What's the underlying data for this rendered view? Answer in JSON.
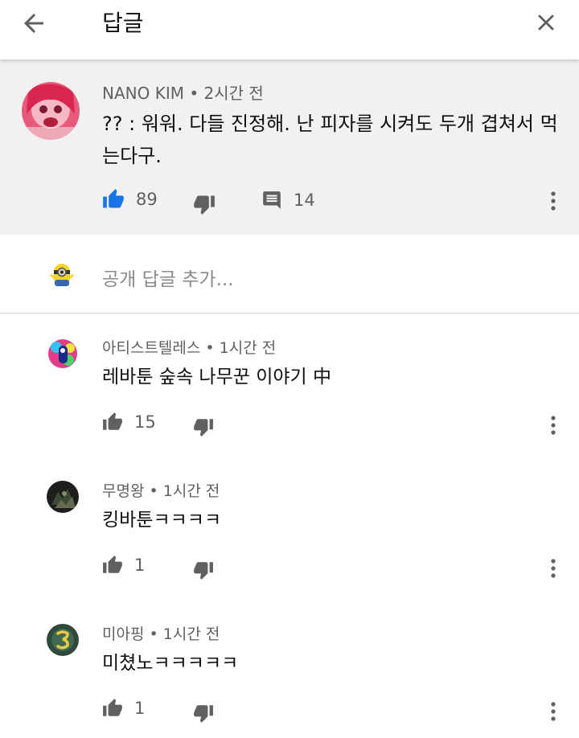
{
  "header": {
    "title": "답글"
  },
  "parent": {
    "author": "NANO KIM",
    "time": "2시간 전",
    "text": "?? : 워워. 다들 진정해. 난 피자를 시켜도 두개 겹쳐서 먹는다구.",
    "likes": "89",
    "replies": "14"
  },
  "add_reply": {
    "placeholder": "공개 답글 추가..."
  },
  "replies": [
    {
      "author": "아티스트텔레스",
      "time": "1시간 전",
      "text": "레바툰 숲속 나무꾼 이야기 中",
      "likes": "15"
    },
    {
      "author": "무명왕",
      "time": "1시간 전",
      "text": "킹바툰ㅋㅋㅋㅋ",
      "likes": "1"
    },
    {
      "author": "미아핑",
      "time": "1시간 전",
      "text": "미쳤노ㅋㅋㅋㅋㅋ",
      "likes": "1"
    }
  ],
  "icons": {
    "back": "arrow-left-icon",
    "close": "close-icon",
    "like": "thumbs-up-icon",
    "dislike": "thumbs-down-icon",
    "reply": "comment-icon",
    "more": "more-vertical-icon"
  },
  "colors": {
    "like_active": "#1a73e8",
    "icon_gray": "#606060",
    "highlight_bg": "#f1f1f1"
  }
}
